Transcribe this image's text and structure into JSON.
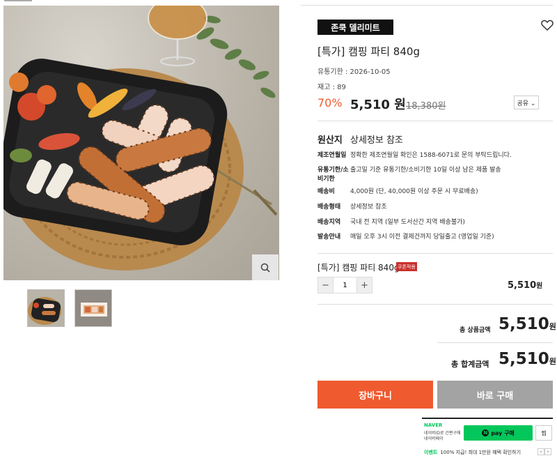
{
  "product": {
    "brand": "존쿡 델리미트",
    "title": "[특가] 캠핑 파티 840g",
    "expire_label": "유통기한 : ",
    "expire_value": "2026-10-05",
    "stock_label": "재고 : ",
    "stock_value": "89",
    "discount": "70%",
    "price": "5,510 원",
    "original_price": "18,380원",
    "share_label": "공유 ⌄"
  },
  "origin": {
    "label": "원산지",
    "value": "상세정보 참조"
  },
  "info_rows": [
    {
      "label": "제조연월일",
      "value": "정확한 제조연월일 확인은 1588-6071로 문의 부탁드립니다."
    },
    {
      "label": "유통기한/소비기한",
      "value": "출고일 기준 유통기한/소비기한 10일 이상 남은 제품 발송"
    },
    {
      "label": "배송비",
      "value": "4,000원 (단, 40,000원 이상 주문 시 무료배송)"
    },
    {
      "label": "배송형태",
      "value": "상세정보 참조"
    },
    {
      "label": "배송지역",
      "value": "국내 전 지역 (일부 도서산간 지역 배송불가)"
    },
    {
      "label": "발송안내",
      "value": "매일 오후 3시 이전 결제건까지 당일출고 (영업일 기준)"
    }
  ],
  "option": {
    "name": "[특가] 캠핑 파티 840g",
    "coupon_badge": "쿠폰적용",
    "qty_minus": "−",
    "qty": "1",
    "qty_plus": "+",
    "price": "5,510",
    "price_unit": "원"
  },
  "totals": {
    "product_label": "총 상품금액",
    "product_value": "5,510",
    "product_unit": "원",
    "total_label": "총 합계금액",
    "total_value": "5,510",
    "total_unit": "원"
  },
  "actions": {
    "cart": "장바구니",
    "buy": "바로 구매"
  },
  "naver": {
    "logo": "NAVER",
    "sub1": "네이버ID로 간편구매",
    "sub2": "네이버페이",
    "npay_n": "N",
    "npay_label": "pay 구매",
    "zzim": "찜",
    "event_label": "이벤트",
    "event_text": "100% 지급! 최대 1만원 혜택 확인하기",
    "prev": "‹",
    "next": "›"
  },
  "colors": {
    "accent": "#ef5a2f",
    "buy_button": "#a3a3a3",
    "naver_green": "#03c75a",
    "brand_badge": "#111111"
  },
  "icons": {
    "favorite": "heart-icon",
    "zoom": "search-icon"
  }
}
